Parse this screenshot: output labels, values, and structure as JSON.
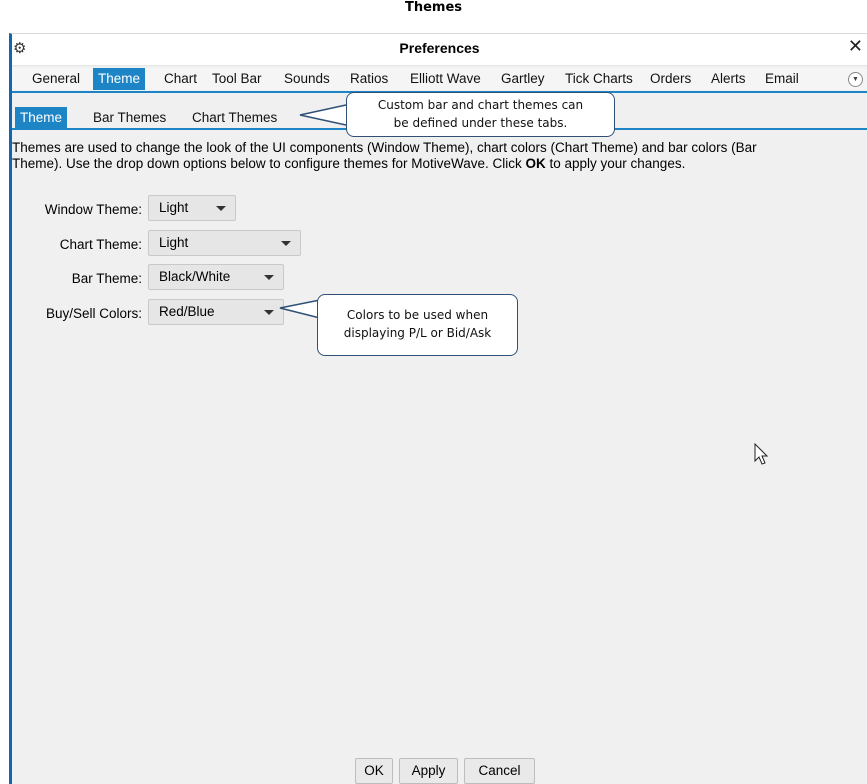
{
  "doc_title": "Themes",
  "window": {
    "title": "Preferences",
    "close_label": "✕",
    "gear_label": "⚙"
  },
  "tabs": [
    {
      "label": "General"
    },
    {
      "label": "Theme"
    },
    {
      "label": "Chart"
    },
    {
      "label": "Tool Bar"
    },
    {
      "label": "Sounds"
    },
    {
      "label": "Ratios"
    },
    {
      "label": "Elliott Wave"
    },
    {
      "label": "Gartley"
    },
    {
      "label": "Tick Charts"
    },
    {
      "label": "Orders"
    },
    {
      "label": "Alerts"
    },
    {
      "label": "Email"
    }
  ],
  "active_tab": "Theme",
  "subtabs": [
    {
      "label": "Theme"
    },
    {
      "label": "Bar Themes"
    },
    {
      "label": "Chart Themes"
    }
  ],
  "description": {
    "line1": "Themes are used to change the look of the UI components (Window Theme), chart colors (Chart Theme) and bar colors (Bar",
    "line2_pre": "Theme).  Use the drop down options below to configure themes for MotiveWave.  Click ",
    "line2_bold": "OK",
    "line2_post": " to apply your changes."
  },
  "settings": {
    "window_theme": {
      "label": "Window Theme:",
      "value": "Light"
    },
    "chart_theme": {
      "label": "Chart Theme:",
      "value": "Light"
    },
    "bar_theme": {
      "label": "Bar Theme:",
      "value": "Black/White"
    },
    "buy_sell_colors": {
      "label": "Buy/Sell Colors:",
      "value": "Red/Blue"
    }
  },
  "callouts": {
    "tabs_callout": {
      "line1": "Custom bar and chart themes can",
      "line2": "be defined under these tabs."
    },
    "colors_callout": {
      "line1": "Colors to be used when",
      "line2": "displaying P/L or Bid/Ask"
    }
  },
  "buttons": {
    "ok": "OK",
    "apply": "Apply",
    "cancel": "Cancel"
  },
  "colors": {
    "accent": "#1d84c6",
    "window_border": "#0f67b1",
    "callout_border": "#2f5077"
  }
}
